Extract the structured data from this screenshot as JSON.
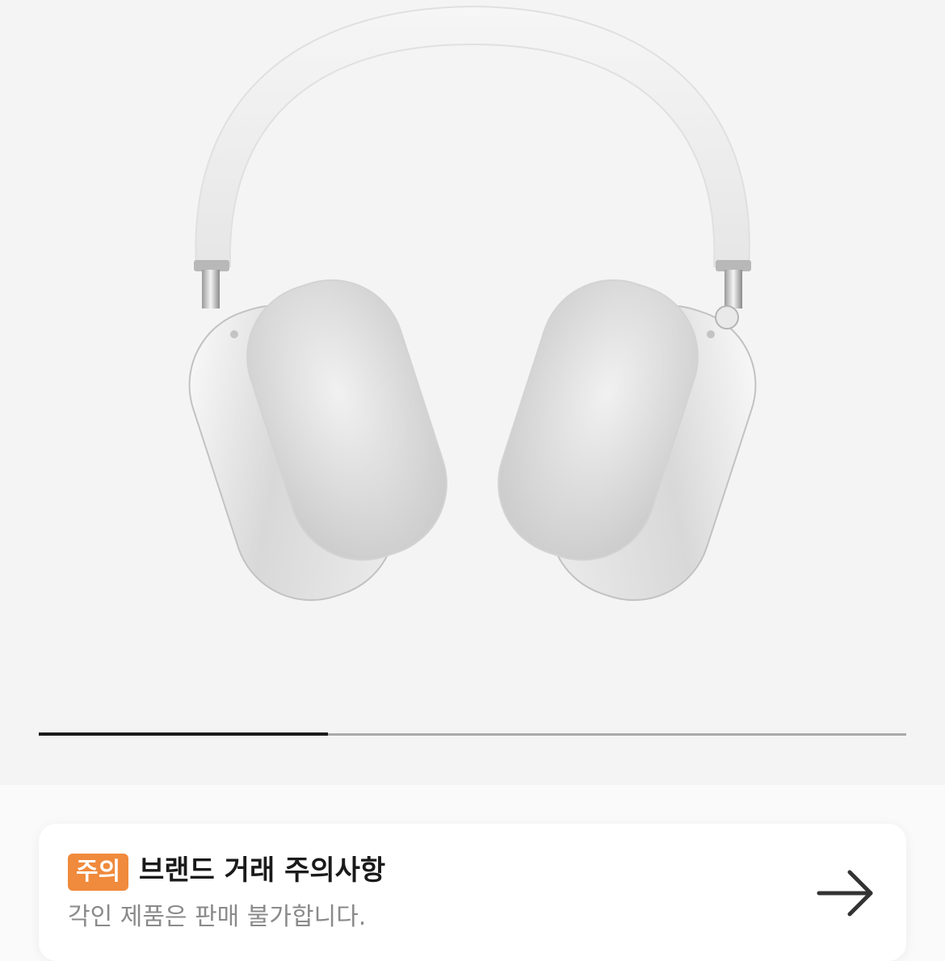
{
  "product": {
    "image_icon": "over-ear-headphones-photo",
    "image_index": 1,
    "image_count": 3
  },
  "notice": {
    "badge": "주의",
    "title": "브랜드 거래 주의사항",
    "description": "각인 제품은 판매 불가합니다.",
    "action_icon": "arrow-right-icon",
    "badge_color": "#f08a3c"
  }
}
